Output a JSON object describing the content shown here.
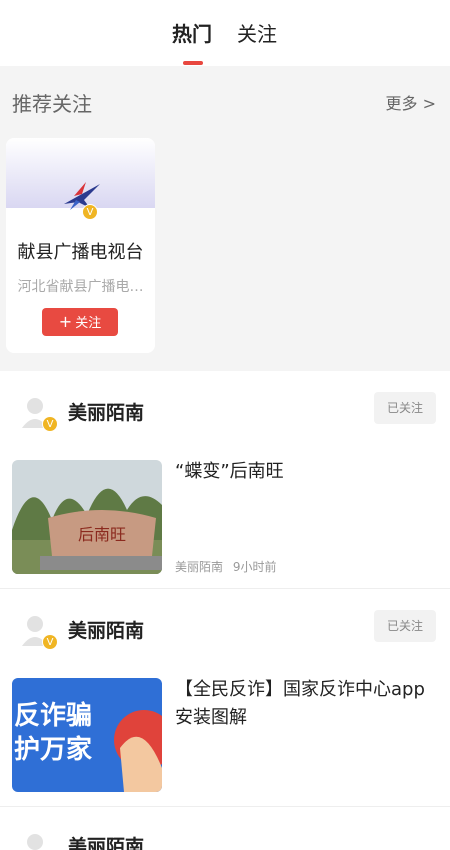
{
  "tabs": [
    {
      "label": "热门"
    },
    {
      "label": "关注"
    }
  ],
  "recommend": {
    "title": "推荐关注",
    "more": "更多 >",
    "cards": [
      {
        "name": "献县广播电视台",
        "description": "河北省献县广播电…",
        "follow_label": "关注",
        "badge": "V"
      }
    ]
  },
  "feed": [
    {
      "user": "美丽陌南",
      "followed_label": "已关注",
      "headline": "“蝶变”后南旺",
      "source": "美丽陌南",
      "time": "9小时前",
      "badge": "V",
      "stone_text": "后南旺"
    },
    {
      "user": "美丽陌南",
      "followed_label": "已关注",
      "headline": "【全民反诈】国家反诈中心app安装图解",
      "badge": "V",
      "thumb_text_line1": "反诈骗",
      "thumb_text_line2": "护万家"
    },
    {
      "user": "美丽陌南"
    }
  ],
  "colors": {
    "accent": "#e84a41",
    "badge": "#f0b524",
    "section_bg": "#f4f4f4"
  }
}
